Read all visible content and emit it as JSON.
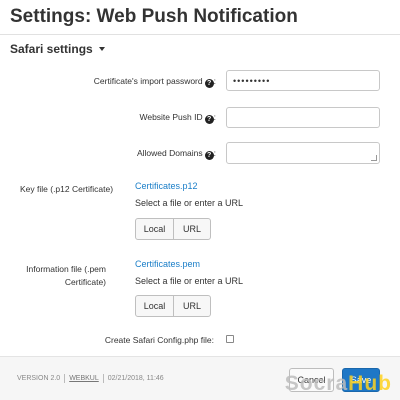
{
  "page": {
    "title": "Settings: Web Push Notification"
  },
  "section": {
    "label": "Safari settings"
  },
  "fields": {
    "cert_password": {
      "label": "Certificate's import password",
      "value": "•••••••••",
      "help_icon": "question-circle-icon"
    },
    "website_push_id": {
      "label": "Website Push ID",
      "value": "",
      "help_icon": "question-circle-icon"
    },
    "allowed_domains": {
      "label": "Allowed Domains",
      "value": "",
      "help_icon": "question-circle-icon"
    }
  },
  "key_file": {
    "label": "Key file (.p12 Certificate)",
    "file_link": "Certificates.p12",
    "hint": "Select a file or enter a URL",
    "local_label": "Local",
    "url_label": "URL"
  },
  "info_file": {
    "label_line1": "Information file (.pem",
    "label_line2": "Certificate)",
    "file_link": "Certificates.pem",
    "hint": "Select a file or enter a URL",
    "local_label": "Local",
    "url_label": "URL"
  },
  "config_file": {
    "label": "Create Safari Config.php file:",
    "checked": false
  },
  "footer": {
    "version": "VERSION 2.0",
    "brand": "WEBKUL",
    "timestamp": "02/21/2018, 11:46",
    "cancel_label": "Cancel",
    "save_label": "Save"
  },
  "watermark": {
    "part1": "Socra",
    "part2": "Hub"
  },
  "colors": {
    "accent": "#1e77c6",
    "link": "#1a7ec8",
    "watermark_yellow": "#ffd21f"
  }
}
